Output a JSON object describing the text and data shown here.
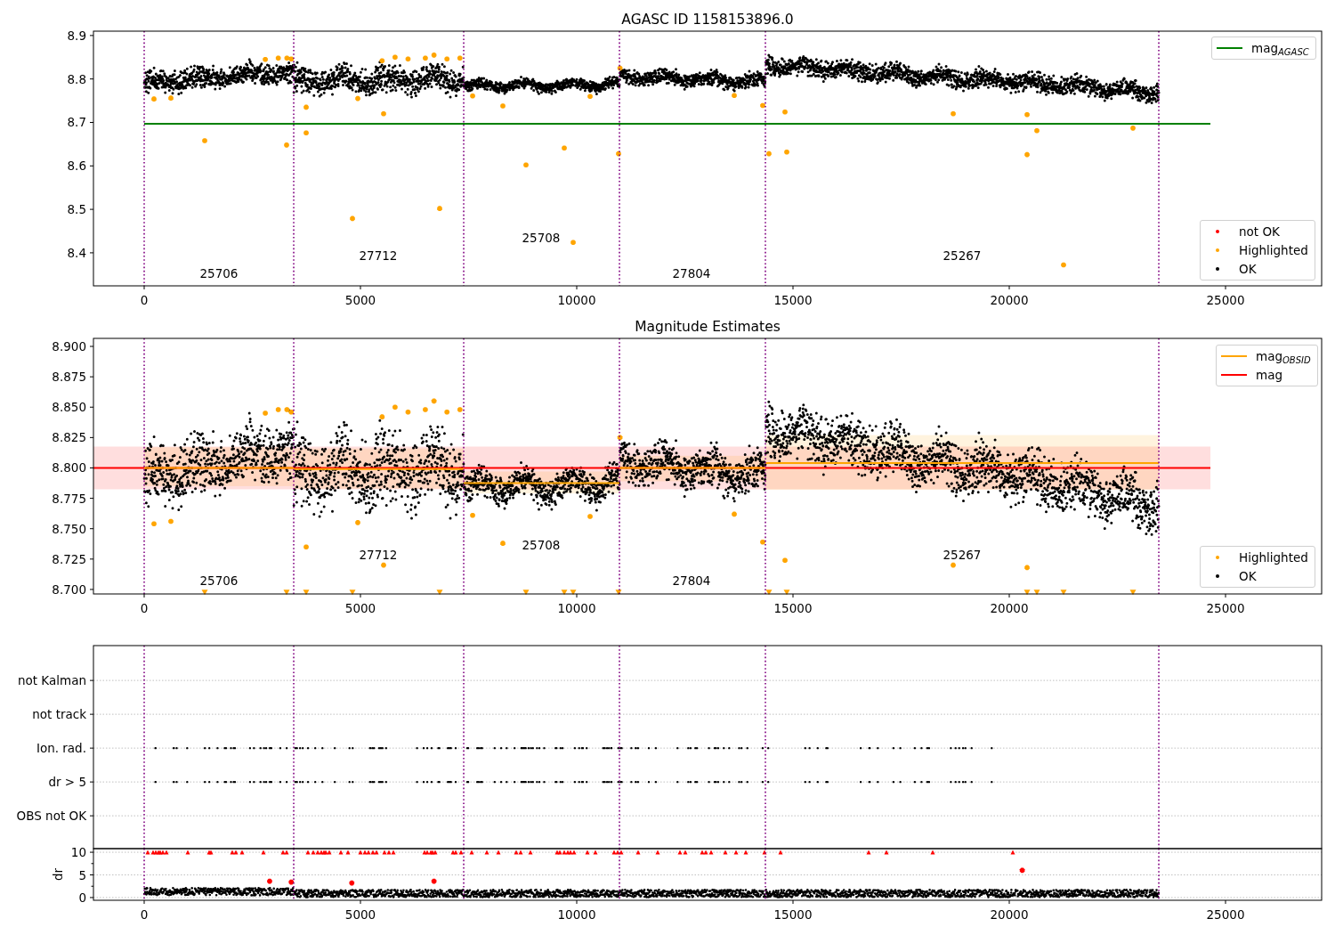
{
  "panels": [
    {
      "chart_data": {
        "type": "scatter",
        "title": "AGASC ID 1158153896.0",
        "xlim": [
          -1173,
          27222
        ],
        "ylim": [
          8.324,
          8.91
        ],
        "xticks": [
          0,
          5000,
          10000,
          15000,
          20000,
          25000
        ],
        "yticks": [
          {
            "value": 8.4,
            "label": "8.4"
          },
          {
            "value": 8.5,
            "label": "8.5"
          },
          {
            "value": 8.6,
            "label": "8.6"
          },
          {
            "value": 8.7,
            "label": "8.7"
          },
          {
            "value": 8.8,
            "label": "8.8"
          },
          {
            "value": 8.9,
            "label": "8.9"
          }
        ],
        "ref_lines": [
          {
            "axis": "x",
            "value": 0
          },
          {
            "axis": "x",
            "value": 3457
          },
          {
            "axis": "x",
            "value": 7387
          },
          {
            "axis": "x",
            "value": 10988
          },
          {
            "axis": "x",
            "value": 14362
          },
          {
            "axis": "x",
            "value": 23457
          }
        ],
        "series": [
          {
            "type": "line",
            "color": "#008000",
            "x": [
              0,
              24650
            ],
            "values": [
              8.697,
              8.697
            ]
          },
          {
            "type": "scatter",
            "color": "#ffa500",
            "x": [
              226,
              617,
              1399,
              2800,
              3100,
              3292,
              3300,
              3400,
              3745,
              3745,
              4815,
              4938,
              5500,
              5535,
              5800,
              6100,
              6500,
              6700,
              6831,
              7000,
              7300,
              7593,
              8292,
              8827,
              9712,
              9918,
              10309,
              10967,
              11000,
              13642,
              14300,
              14444,
              14815,
              14856,
              18704,
              20412,
              20412,
              20638,
              21255,
              22860
            ],
            "values": [
              8.754,
              8.756,
              8.658,
              8.845,
              8.848,
              8.648,
              8.848,
              8.846,
              8.676,
              8.735,
              8.479,
              8.755,
              8.842,
              8.72,
              8.85,
              8.846,
              8.848,
              8.855,
              8.502,
              8.846,
              8.848,
              8.761,
              8.738,
              8.602,
              8.641,
              8.424,
              8.76,
              8.628,
              8.825,
              8.762,
              8.739,
              8.628,
              8.724,
              8.632,
              8.72,
              8.626,
              8.718,
              8.681,
              8.372,
              8.687
            ]
          }
        ],
        "annotations": [
          "25706",
          "27712",
          "25708",
          "27804",
          "25267"
        ]
      },
      "legends": [
        {
          "entries": [
            {
              "label": "mag$_{AGASC}$",
              "kind": "line",
              "color": "#008000"
            }
          ]
        },
        {
          "entries": [
            {
              "label": "not OK",
              "kind": "dot",
              "color": "#ff0000"
            },
            {
              "label": "Highlighted",
              "kind": "dot",
              "color": "#ffa500"
            },
            {
              "label": "OK",
              "kind": "dot",
              "color": "#000000"
            }
          ]
        }
      ]
    },
    {
      "chart_data": {
        "type": "scatter",
        "title": "Magnitude Estimates",
        "xlim": [
          -1173,
          27222
        ],
        "ylim": [
          8.6963,
          8.9066
        ],
        "xticks": [
          0,
          5000,
          10000,
          15000,
          20000,
          25000
        ],
        "yticks": [
          {
            "value": 8.7,
            "label": "8.700"
          },
          {
            "value": 8.725,
            "label": "8.725"
          },
          {
            "value": 8.75,
            "label": "8.750"
          },
          {
            "value": 8.775,
            "label": "8.775"
          },
          {
            "value": 8.8,
            "label": "8.800"
          },
          {
            "value": 8.825,
            "label": "8.825"
          },
          {
            "value": 8.85,
            "label": "8.850"
          },
          {
            "value": 8.875,
            "label": "8.875"
          },
          {
            "value": 8.9,
            "label": "8.900"
          }
        ],
        "ref_lines": [
          {
            "axis": "x",
            "value": 0
          },
          {
            "axis": "x",
            "value": 3457
          },
          {
            "axis": "x",
            "value": 7387
          },
          {
            "axis": "x",
            "value": 10988
          },
          {
            "axis": "x",
            "value": 14362
          },
          {
            "axis": "x",
            "value": 23457
          }
        ],
        "bands": [
          {
            "axis": "y",
            "from": 8.7824,
            "to": 8.8176,
            "color": "#ff0000"
          },
          {
            "axis": "y",
            "from": 8.785,
            "to": 8.817,
            "color": "#ffa500"
          },
          {
            "axis": "y",
            "from": 8.783,
            "to": 8.816,
            "color": "#ffa500"
          },
          {
            "axis": "y",
            "from": 8.779,
            "to": 8.797,
            "color": "#ffa500"
          },
          {
            "axis": "y",
            "from": 8.789,
            "to": 8.81,
            "color": "#ffa500"
          },
          {
            "axis": "y",
            "from": 8.782,
            "to": 8.827,
            "color": "#ffa500"
          }
        ],
        "series": [
          {
            "type": "line",
            "color": "#ff0000",
            "x": [
              -1173,
              24650
            ],
            "values": [
              8.8,
              8.8
            ]
          },
          {
            "type": "line",
            "color": "#ffa500",
            "x": [
              0,
              3457,
              null,
              3457,
              7387,
              null,
              7387,
              10988,
              null,
              10988,
              14362,
              null,
              14362,
              23457
            ],
            "values": [
              8.8,
              8.8,
              null,
              8.799,
              8.799,
              null,
              8.7875,
              8.7875,
              null,
              8.8,
              8.8,
              null,
              8.804,
              8.804
            ]
          },
          {
            "type": "scatter",
            "color": "#ffa500",
            "x": [
              226,
              617,
              2800,
              3100,
              3300,
              3400,
              3745,
              4938,
              5500,
              5535,
              5800,
              6100,
              6500,
              6700,
              7000,
              7300,
              7593,
              8292,
              10309,
              11000,
              13642,
              14300,
              14815,
              18704,
              20412
            ],
            "values": [
              8.754,
              8.756,
              8.845,
              8.848,
              8.848,
              8.846,
              8.735,
              8.755,
              8.842,
              8.72,
              8.85,
              8.846,
              8.848,
              8.855,
              8.846,
              8.848,
              8.761,
              8.738,
              8.76,
              8.825,
              8.762,
              8.739,
              8.724,
              8.72,
              8.718
            ]
          },
          {
            "type": "scatter",
            "marker": "v",
            "color": "#ffa500",
            "x": [
              1399,
              3292,
              3745,
              4815,
              6831,
              8827,
              9712,
              9918,
              10967,
              14444,
              14856,
              20412,
              20638,
              21255,
              22860
            ],
            "values": [
              8.6975,
              8.6975,
              8.6975,
              8.6975,
              8.6975,
              8.6975,
              8.6975,
              8.6975,
              8.6975,
              8.6975,
              8.6975,
              8.6975,
              8.6975,
              8.6975,
              8.6975
            ]
          }
        ],
        "annotations": [
          "25706",
          "27712",
          "25708",
          "27804",
          "25267"
        ]
      },
      "legends": [
        {
          "entries": [
            {
              "label": "mag$_{OBSID}$",
              "kind": "line",
              "color": "#ffa500"
            },
            {
              "label": "mag",
              "kind": "line",
              "color": "#ff0000"
            }
          ]
        },
        {
          "entries": [
            {
              "label": "Highlighted",
              "kind": "dot",
              "color": "#ffa500"
            },
            {
              "label": "OK",
              "kind": "dot",
              "color": "#000000"
            }
          ]
        }
      ]
    },
    {
      "chart_data": {
        "type": "scatter",
        "orientation": "horizontal",
        "xlim": [
          -1173,
          27222
        ],
        "grid": true,
        "categories": [
          "not Kalman",
          "not track",
          "Ion. rad.",
          "dr > 5",
          "OBS not OK"
        ],
        "ref_lines": [
          {
            "axis": "x",
            "value": 0
          },
          {
            "axis": "x",
            "value": 3457
          },
          {
            "axis": "x",
            "value": 7387
          },
          {
            "axis": "x",
            "value": 10988
          },
          {
            "axis": "x",
            "value": 14362
          },
          {
            "axis": "x",
            "value": 23457
          }
        ]
      }
    },
    {
      "chart_data": {
        "type": "scatter",
        "ylabel": "dr",
        "xlim": [
          -1173,
          27222
        ],
        "ylim": [
          -0.6,
          10.8
        ],
        "grid": true,
        "xticks": [
          0,
          5000,
          10000,
          15000,
          20000,
          25000
        ],
        "yticks": [
          0,
          5,
          10
        ],
        "ref_lines": [
          {
            "axis": "x",
            "value": 0
          },
          {
            "axis": "x",
            "value": 3457
          },
          {
            "axis": "x",
            "value": 7387
          },
          {
            "axis": "x",
            "value": 10988
          },
          {
            "axis": "x",
            "value": 14362
          },
          {
            "axis": "x",
            "value": 23457
          }
        ],
        "series": [
          {
            "type": "scatter",
            "marker": "^",
            "color": "#ff0000",
            "x": [
              82,
              206,
              267,
              329,
              370,
              432,
              514,
              1008,
              1502,
              1543,
              2037,
              2119,
              2263,
              2757,
              3210,
              3292,
              3786,
              3909,
              4012,
              4095,
              4156,
              4198,
              4280,
              4547,
              4712,
              5000,
              5103,
              5185,
              5288,
              5370,
              5556,
              5658,
              5761,
              6481,
              6543,
              6626,
              6667,
              6728,
              7140,
              7202,
              7325,
              7572,
              7922,
              8189,
              8601,
              8704,
              8930,
              9547,
              9609,
              9712,
              9794,
              9856,
              9938,
              10247,
              10432,
              10864,
              10946,
              11029,
              11420,
              11872,
              12387,
              12510,
              12901,
              12984,
              13107,
              13436,
              13683,
              13909,
              14342,
              14712,
              16749,
              17160,
              18230,
              20082
            ],
            "values": [
              10,
              10,
              10,
              10,
              10,
              10,
              10,
              10,
              10,
              10,
              10,
              10,
              10,
              10,
              10,
              10,
              10,
              10,
              10,
              10,
              10,
              10,
              10,
              10,
              10,
              10,
              10,
              10,
              10,
              10,
              10,
              10,
              10,
              10,
              10,
              10,
              10,
              10,
              10,
              10,
              10,
              10,
              10,
              10,
              10,
              10,
              10,
              10,
              10,
              10,
              10,
              10,
              10,
              10,
              10,
              10,
              10,
              10,
              10,
              10,
              10,
              10,
              10,
              10,
              10,
              10,
              10,
              10,
              10,
              10,
              10,
              10,
              10,
              10
            ]
          },
          {
            "type": "scatter",
            "color": "#ff0000",
            "x": [
              2900,
              3400,
              4800,
              6700,
              20300
            ],
            "values": [
              3.6,
              3.4,
              3.2,
              3.6,
              6
            ]
          }
        ]
      }
    }
  ]
}
